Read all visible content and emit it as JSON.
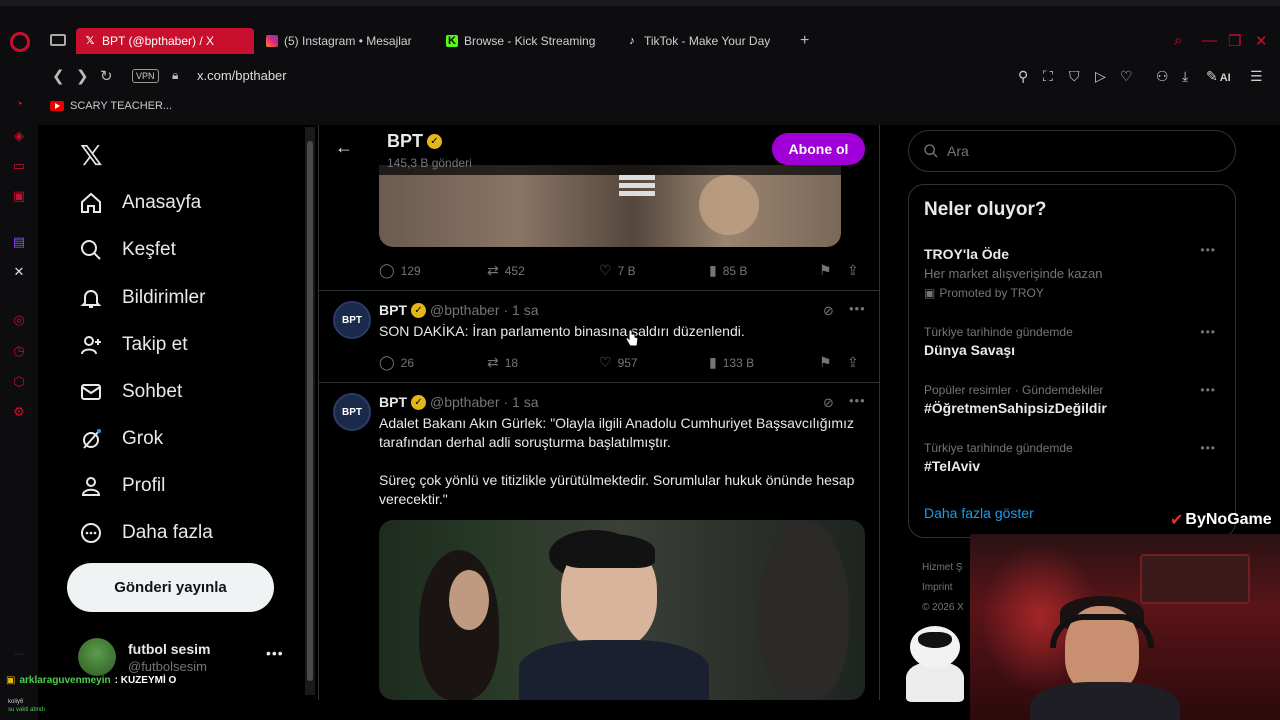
{
  "browser": {
    "tabs": [
      {
        "label": "BPT (@bpthaber) / X",
        "icon": "x-icon",
        "active": true
      },
      {
        "label": "(5) Instagram • Mesajlar",
        "icon": "instagram-icon",
        "active": false
      },
      {
        "label": "Browse - Kick Streaming",
        "icon": "kick-icon",
        "active": false
      },
      {
        "label": "TikTok - Make Your Day",
        "icon": "tiktok-icon",
        "active": false
      }
    ],
    "vpn_label": "VPN",
    "url": "x.com/bpthaber",
    "ai_label": "AI",
    "bookmark": "SCARY TEACHER..."
  },
  "sidebar": {
    "items": [
      {
        "label": "Anasayfa",
        "icon": "home-icon"
      },
      {
        "label": "Keşfet",
        "icon": "search-icon"
      },
      {
        "label": "Bildirimler",
        "icon": "bell-icon"
      },
      {
        "label": "Takip et",
        "icon": "follow-icon"
      },
      {
        "label": "Sohbet",
        "icon": "mail-icon"
      },
      {
        "label": "Grok",
        "icon": "grok-icon"
      },
      {
        "label": "Profil",
        "icon": "profile-icon"
      },
      {
        "label": "Daha fazla",
        "icon": "more-icon"
      }
    ],
    "post_button": "Gönderi yayınla",
    "account": {
      "name": "futbol sesim",
      "handle": "@futbolsesim"
    }
  },
  "header": {
    "name": "BPT",
    "post_count": "145,3 B gönderi",
    "subscribe_button": "Abone ol"
  },
  "tweets": [
    {
      "replies": "129",
      "retweets": "452",
      "likes": "7 B",
      "views": "85 B"
    },
    {
      "avatar_text": "BPT",
      "name": "BPT",
      "handle": "@bpthaber",
      "time": "· 1 sa",
      "text": "SON DAKİKA: İran parlamento binasına saldırı düzenlendi.",
      "replies": "26",
      "retweets": "18",
      "likes": "957",
      "views": "133 B"
    },
    {
      "avatar_text": "BPT",
      "name": "BPT",
      "handle": "@bpthaber",
      "time": "· 1 sa",
      "text": "Adalet Bakanı Akın Gürlek: \"Olayla ilgili Anadolu Cumhuriyet Başsavcılığımız tarafından derhal adli soruşturma başlatılmıştır.\n\nSüreç çok yönlü ve titizlikle yürütülmektedir. Sorumlular hukuk önünde hesap verecektir.\""
    }
  ],
  "right": {
    "search_placeholder": "Ara",
    "trends_title": "Neler oluyor?",
    "trends": [
      {
        "context": "",
        "name": "TROY'la Öde",
        "desc": "Her market alışverişinde kazan",
        "promo": "Promoted by TROY"
      },
      {
        "context": "Türkiye tarihinde gündemde",
        "name": "Dünya Savaşı"
      },
      {
        "context": "Popüler resimler · Gündemdekiler",
        "name": "#ÖğretmenSahipsizDeğildir"
      },
      {
        "context": "Türkiye tarihinde gündemde",
        "name": "#TelAviv"
      }
    ],
    "show_more": "Daha fazla göster",
    "footer": [
      "Hizmet Ş",
      "Imprint",
      "© 2026 X"
    ]
  },
  "overlay": {
    "brand": "ByNoGame",
    "chat_user": "arklaraguvenmeyin",
    "chat_text": ": KUZEYMİ O",
    "chat2_user": "koliy6",
    "chat2_text": "su vakti abndı"
  },
  "colors": {
    "accent": "#c8102e",
    "subscribe": "#a000d8",
    "link": "#1d9bf0",
    "verified": "#e2b719"
  }
}
